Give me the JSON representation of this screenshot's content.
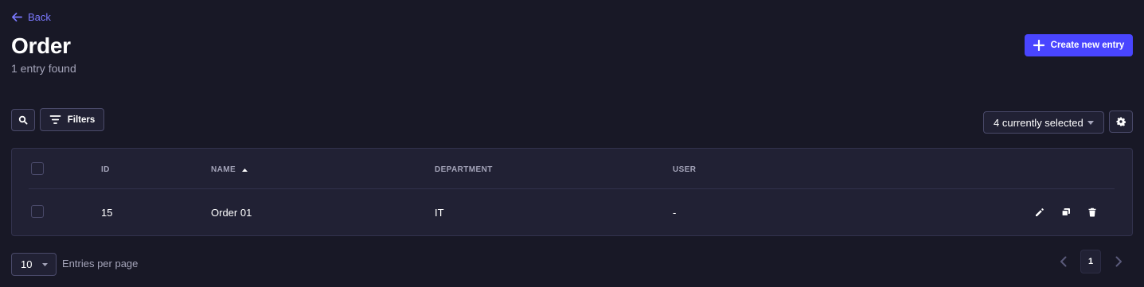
{
  "header": {
    "back_label": "Back",
    "title": "Order",
    "subtitle": "1 entry found",
    "create_label": "Create new entry"
  },
  "toolbar": {
    "filters_label": "Filters",
    "columns_select": "4 currently selected"
  },
  "table": {
    "columns": [
      "ID",
      "Name",
      "Department",
      "User"
    ],
    "sort": {
      "column": "Name",
      "direction": "ascending"
    },
    "rows": [
      {
        "id": "15",
        "name": "Order 01",
        "department": "IT",
        "user": "-"
      }
    ]
  },
  "pagination": {
    "per_page_value": "10",
    "per_page_label": "Entries per page",
    "current_page": "1"
  },
  "colors": {
    "background": "#181826",
    "surface": "#212134",
    "accent": "#4945ff",
    "link": "#7b79ff",
    "muted_text": "#a5a5ba"
  },
  "icons": {
    "back": "arrow-left-icon",
    "create": "plus-icon",
    "search": "search-icon",
    "filters": "filter-icon",
    "settings": "gear-icon",
    "sort": "caret-up-icon",
    "edit": "pencil-icon",
    "duplicate": "duplicate-icon",
    "delete": "trash-icon",
    "prev": "chevron-left-icon",
    "next": "chevron-right-icon"
  }
}
